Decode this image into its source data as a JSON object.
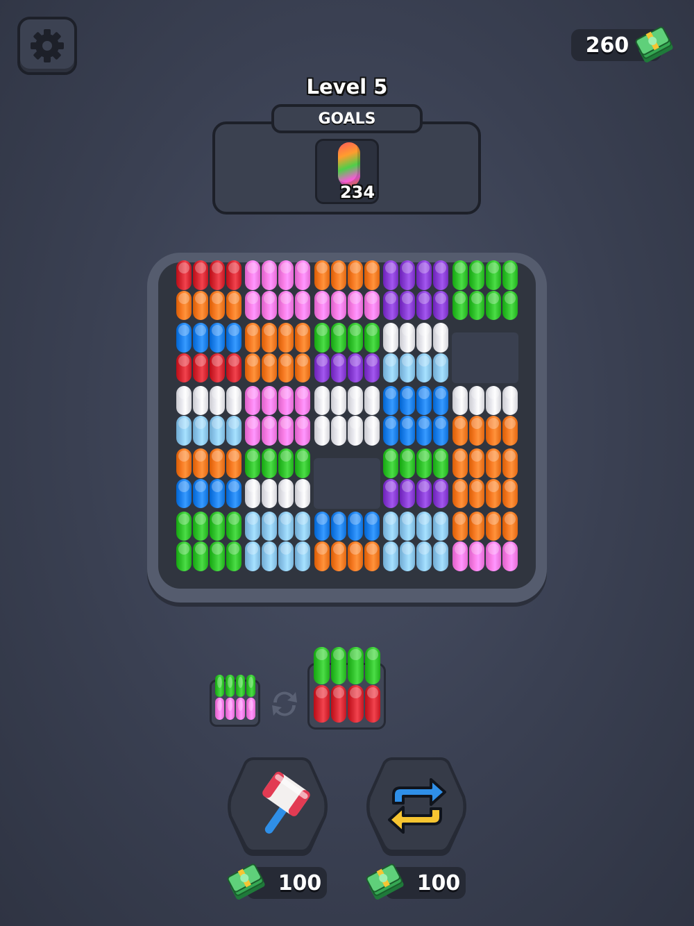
{
  "header": {
    "cash_amount": "260",
    "level_title": "Level 5"
  },
  "goals": {
    "tab_label": "GOALS",
    "count": "234"
  },
  "boosters": {
    "hammer_price": "100",
    "shuffle_price": "100"
  },
  "colors": {
    "red": "#d92a35",
    "orange": "#f77a23",
    "pink": "#f97ee6",
    "purple": "#8a3fd6",
    "green": "#33c42e",
    "blue": "#1f82ee",
    "lightblue": "#8ec9ef",
    "white": "#e8e8ee",
    "background": "#3a4052"
  },
  "board": {
    "rows": 5,
    "cols": 5,
    "cells": [
      [
        [
          "red",
          "red",
          "orange",
          "orange"
        ],
        [
          "pink",
          "pink",
          "pink",
          "pink"
        ],
        [
          "orange",
          "orange",
          "pink",
          "pink"
        ],
        [
          "purple",
          "purple",
          "purple",
          "purple"
        ],
        [
          "green",
          "green",
          "green",
          "green"
        ]
      ],
      [
        [
          "blue",
          "blue",
          "red",
          "red"
        ],
        [
          "orange",
          "orange",
          "orange",
          "orange"
        ],
        [
          "green",
          "green",
          "purple",
          "purple"
        ],
        [
          "white",
          "white",
          "lightblue",
          "lightblue"
        ],
        null
      ],
      [
        [
          "white",
          "white",
          "lightblue",
          "lightblue"
        ],
        [
          "pink",
          "pink",
          "pink",
          "pink"
        ],
        [
          "white",
          "white",
          "white",
          "white"
        ],
        [
          "blue",
          "blue",
          "blue",
          "blue"
        ],
        [
          "white",
          "white",
          "orange",
          "orange"
        ]
      ],
      [
        [
          "orange",
          "orange",
          "blue",
          "blue"
        ],
        [
          "green",
          "green",
          "white",
          "white"
        ],
        null,
        [
          "green",
          "green",
          "purple",
          "purple"
        ],
        [
          "orange",
          "orange",
          "orange",
          "orange"
        ]
      ],
      [
        [
          "green",
          "green",
          "green",
          "green"
        ],
        [
          "lightblue",
          "lightblue",
          "lightblue",
          "lightblue"
        ],
        [
          "blue",
          "blue",
          "orange",
          "orange"
        ],
        [
          "lightblue",
          "lightblue",
          "lightblue",
          "lightblue"
        ],
        [
          "orange",
          "orange",
          "pink",
          "pink"
        ]
      ]
    ]
  },
  "next_pieces": {
    "small": [
      "green",
      "green",
      "pink",
      "pink"
    ],
    "large": [
      "green",
      "green",
      "red",
      "red"
    ]
  }
}
